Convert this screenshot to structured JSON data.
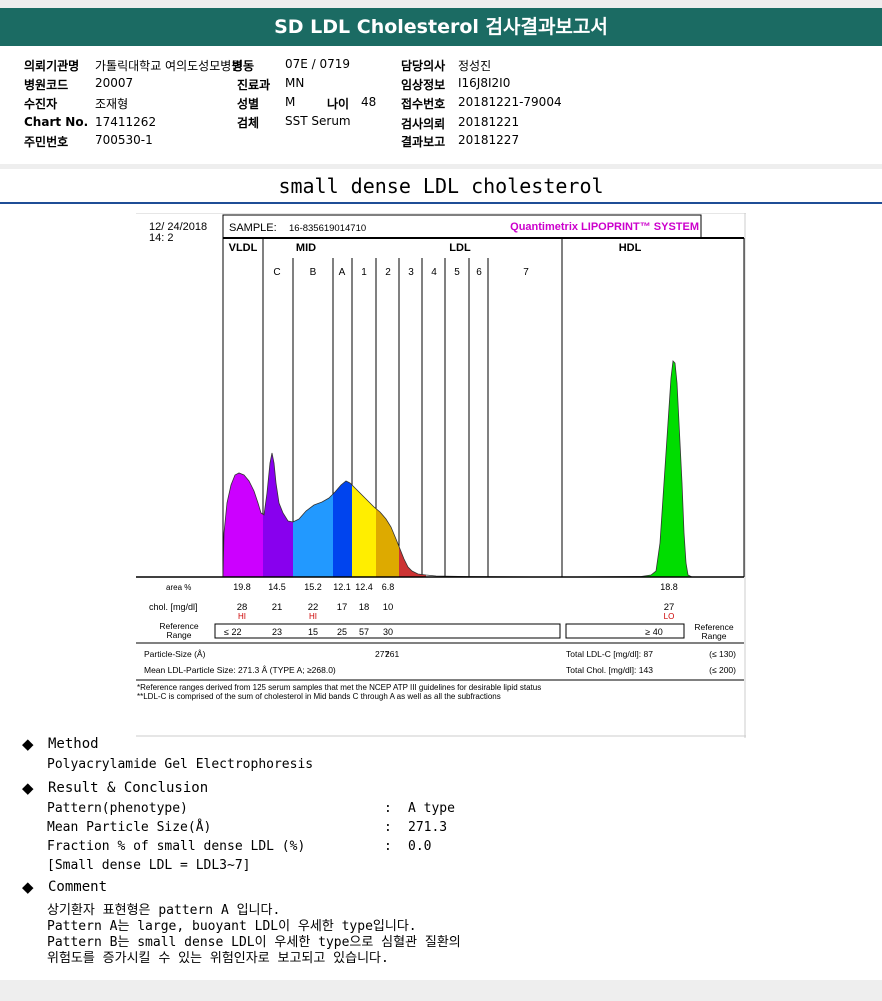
{
  "title": "SD LDL Cholesterol 검사결과보고서",
  "patient_info": {
    "institution_label": "의뢰기관명",
    "institution": "가톨릭대학교 여의도성모병원",
    "ward_label": "병동",
    "ward": "07E / 0719",
    "doctor_label": "담당의사",
    "doctor": "정성진",
    "hospital_code_label": "병원코드",
    "hospital_code": "20007",
    "dept_label": "진료과",
    "dept": "MN",
    "clinical_label": "임상정보",
    "clinical": "I16J8I2I0",
    "examinee_label": "수진자",
    "examinee": "조재형",
    "sex_label": "성별",
    "sex": "M",
    "age_label": "나이",
    "age": "48",
    "receipt_label": "접수번호",
    "receipt": "20181221-79004",
    "chart_label": "Chart No.",
    "chart": "17411262",
    "specimen_label": "검체",
    "specimen": "SST Serum",
    "request_label": "검사의뢰",
    "request": "20181221",
    "resident_label": "주민번호",
    "resident": "700530-1",
    "result_label": "결과보고",
    "result": "20181227"
  },
  "section_title": "small dense LDL cholesterol",
  "report": {
    "date": "12/ 24/2018",
    "time": "14: 2",
    "sample_label": "SAMPLE:",
    "sample": "16-835619014710",
    "system": "Quantimetrix LIPOPRINT™ SYSTEM",
    "group_vldl": "VLDL",
    "group_mid": "MID",
    "group_ldl": "LDL",
    "group_hdl": "HDL",
    "row_area_label": "area %",
    "row_chol_label": "chol. [mg/dl]",
    "row_ref_label_1": "Reference",
    "row_ref_label_2": "Range",
    "ref_right_1": "Reference",
    "ref_right_2": "Range",
    "particle_size_label": "Particle-Size (Å)",
    "particle_size_1": "277",
    "particle_size_2": "261",
    "mean_ldl_label": "Mean LDL-Particle Size:  271.3 Å  (TYPE A; ≥268.0)",
    "total_ldl_label": "Total LDL-C [mg/dl]: 87",
    "total_ldl_ref": "(≤ 130)",
    "total_chol_label": "Total Chol. [mg/dl]:   143",
    "total_chol_ref": "(≤ 200)",
    "footnote_1": "*Reference ranges derived from 125 serum samples that met the NCEP ATP III guidelines for desirable lipid status",
    "footnote_2": "**LDL-C is comprised of the sum of cholesterol in Mid bands C through A as well as all the subfractions"
  },
  "chart_data": {
    "type": "area",
    "title": "",
    "bands": [
      "VLDL",
      "C",
      "B",
      "A",
      "1",
      "2",
      "3",
      "4",
      "5",
      "6",
      "7",
      "HDL"
    ],
    "band_colors": [
      "#cc00ff",
      "#8800ee",
      "#2299ff",
      "#0044ee",
      "#ffee00",
      "#ddaa00",
      "#cc3333",
      "",
      "",
      "",
      "",
      "#00dd00"
    ],
    "table": {
      "area_pct": [
        "19.8",
        "14.5",
        "15.2",
        "12.1",
        "12.4",
        "6.8",
        "",
        "",
        "",
        "",
        "",
        "18.8"
      ],
      "chol_mg_dl": [
        "28",
        "21",
        "22",
        "17",
        "18",
        "10",
        "",
        "",
        "",
        "",
        "",
        "27"
      ],
      "flags": [
        "HI",
        "",
        "HI",
        "",
        "",
        "",
        "",
        "",
        "",
        "",
        "",
        "LO"
      ],
      "reference_range": [
        "≤ 22",
        "23",
        "15",
        "25",
        "57",
        "30",
        "",
        "",
        "",
        "",
        "",
        "≥ 40"
      ]
    }
  },
  "method": {
    "heading": "Method",
    "text": "Polyacrylamide Gel Electrophoresis"
  },
  "result_section": {
    "heading": "Result & Conclusion",
    "rows": [
      {
        "label": "Pattern(phenotype)",
        "value": "A type"
      },
      {
        "label": "Mean Particle Size(Å)",
        "value": "271.3"
      },
      {
        "label": "Fraction % of small dense LDL (%)",
        "value": "0.0"
      }
    ],
    "note": "[Small dense LDL = LDL3~7]",
    "colon": ":"
  },
  "comment": {
    "heading": "Comment",
    "lines": [
      "상기환자 표현형은 pattern A 입니다.",
      "Pattern A는 large, buoyant LDL이 우세한 type입니다.",
      "Pattern B는 small dense LDL이 우세한 type으로 심혈관 질환의",
      "위험도를 증가시킬 수 있는 위험인자로 보고되고 있습니다."
    ]
  },
  "diamond": "◆"
}
